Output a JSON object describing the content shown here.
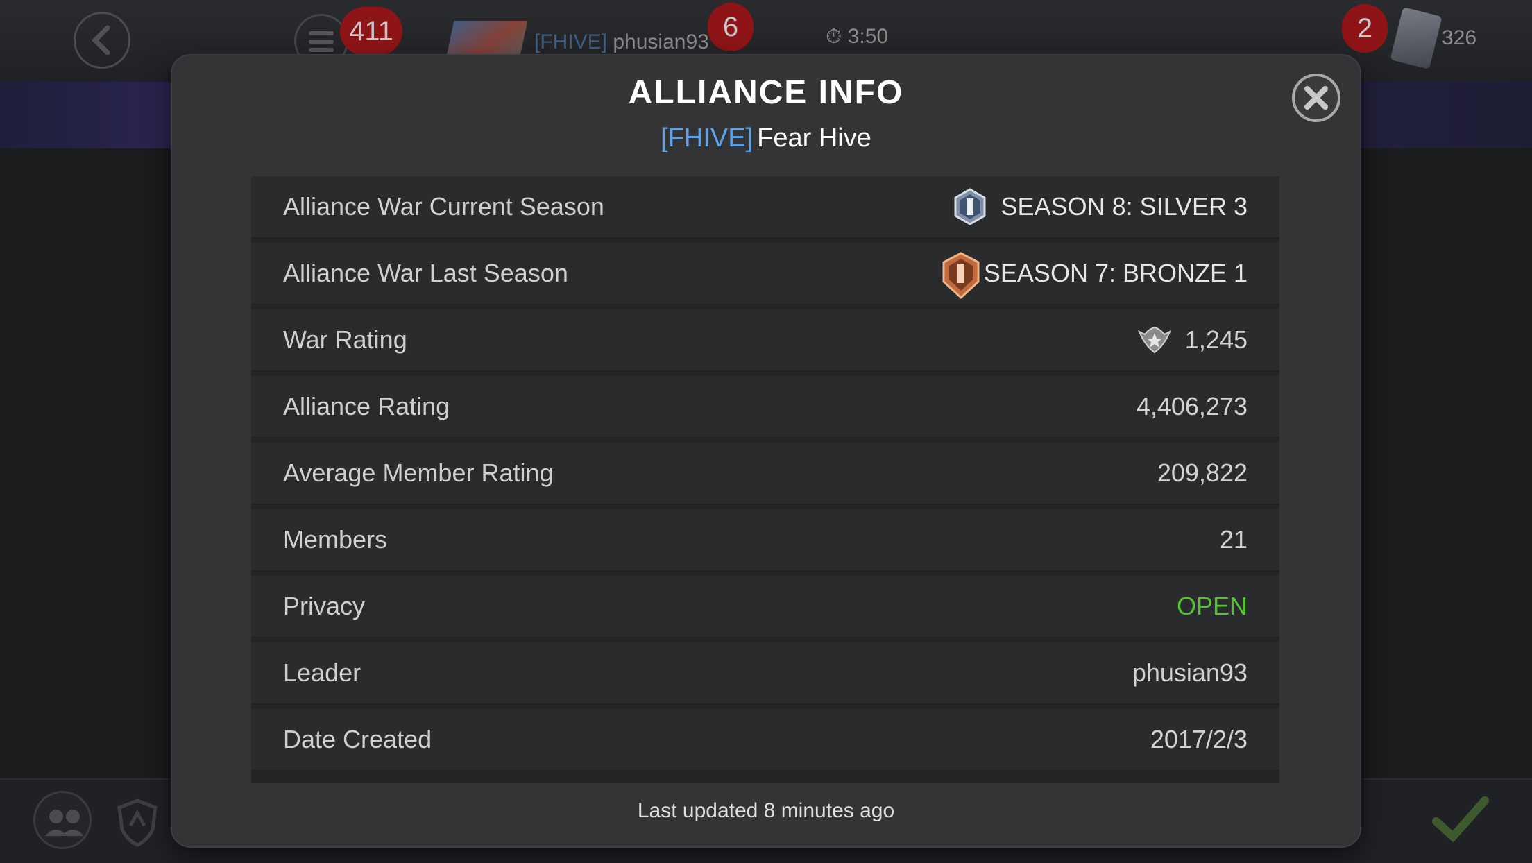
{
  "top_bar": {
    "notifications_count": "411",
    "alliance_tag": "[FHIVE]",
    "player_name": "phusian93",
    "mail_count": "6",
    "timer": "3:50",
    "alert_count": "2",
    "currency_amount": "326"
  },
  "modal": {
    "title": "ALLIANCE INFO",
    "alliance_tag": "[FHIVE]",
    "alliance_name": "Fear Hive",
    "rows": [
      {
        "label": "Alliance War Current Season",
        "value": "SEASON 8: SILVER 3",
        "icon": "silver-tier-badge-icon"
      },
      {
        "label": "Alliance War Last Season",
        "value": "SEASON 7: BRONZE 1",
        "icon": "bronze-tier-badge-icon"
      },
      {
        "label": "War Rating",
        "value": "1,245",
        "icon": "war-rating-emblem-icon"
      },
      {
        "label": "Alliance Rating",
        "value": "4,406,273"
      },
      {
        "label": "Average Member Rating",
        "value": "209,822"
      },
      {
        "label": "Members",
        "value": "21"
      },
      {
        "label": "Privacy",
        "value": "OPEN",
        "color": "#55c232"
      },
      {
        "label": "Leader",
        "value": "phusian93"
      },
      {
        "label": "Date Created",
        "value": "2017/2/3"
      }
    ],
    "footer": "Last updated 8 minutes ago"
  },
  "colors": {
    "accent_tag": "#5fa2ea",
    "open_status": "#55c232",
    "modal_bg": "#333436"
  }
}
